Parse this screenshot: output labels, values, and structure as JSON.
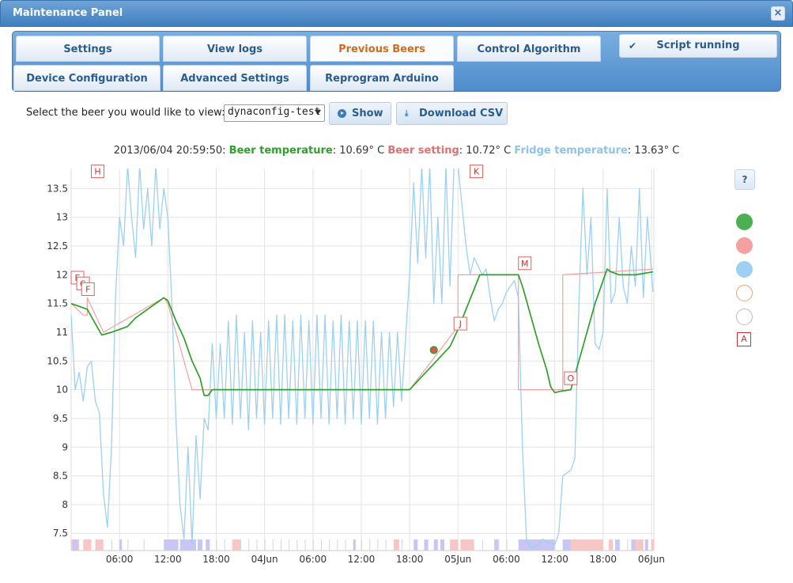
{
  "window": {
    "title": "Maintenance Panel",
    "close_glyph": "×"
  },
  "tabs": [
    {
      "label": "Settings",
      "active": false
    },
    {
      "label": "View logs",
      "active": false
    },
    {
      "label": "Previous Beers",
      "active": true
    },
    {
      "label": "Control Algorithm",
      "active": false
    },
    {
      "label": "Device Configuration",
      "active": false
    },
    {
      "label": "Advanced Settings",
      "active": false
    },
    {
      "label": "Reprogram Arduino",
      "active": false
    }
  ],
  "script_status": {
    "label": "Script running",
    "icon": "check-icon"
  },
  "controls": {
    "select_label": "Select the beer you would like to view:",
    "beer_value": "dynaconfig-test",
    "show_label": "Show",
    "show_icon": "play-circle-icon",
    "download_label": "Download CSV",
    "download_icon": "download-icon"
  },
  "readout": {
    "timestamp": "2013/06/04 20:59:50:",
    "beer_label": "Beer temperature",
    "beer_value": ": 10.69° C",
    "setting_label": "Beer setting",
    "setting_value": ": 10.72° C",
    "fridge_label": "Fridge temperature",
    "fridge_value": ": 13.63° C"
  },
  "legend": {
    "help_label": "?",
    "colors": [
      "#4caf50",
      "#f4a0a0",
      "#9fd0f3",
      "#f0a060",
      "#cccccc"
    ],
    "annotations_label": "A"
  },
  "colors": {
    "beer": "#2ea02a",
    "setting": "#f3a0a0",
    "fridge": "#9dd0f2",
    "accent": "#d06b1e"
  },
  "chart_data": {
    "type": "line",
    "x_unit": "hours since 2013-06-03 00:00",
    "x_tick_labels": [
      "06:00",
      "12:00",
      "18:00",
      "04Jun",
      "06:00",
      "12:00",
      "18:00",
      "05Jun",
      "06:00",
      "12:00",
      "18:00",
      "06Jun"
    ],
    "x_ticks": [
      6,
      12,
      18,
      24,
      30,
      36,
      42,
      48,
      54,
      60,
      66,
      72
    ],
    "xlim": [
      0,
      72.3
    ],
    "ylim": [
      7.2,
      13.85
    ],
    "y_ticks": [
      7.5,
      8,
      8.5,
      9,
      9.5,
      10,
      10.5,
      11,
      11.5,
      12,
      12.5,
      13,
      13.5
    ],
    "series": [
      {
        "name": "Beer temperature",
        "points": [
          [
            0,
            11.5
          ],
          [
            2,
            11.4
          ],
          [
            3.8,
            10.95
          ],
          [
            5,
            11.0
          ],
          [
            6,
            11.05
          ],
          [
            7,
            11.1
          ],
          [
            8,
            11.25
          ],
          [
            10,
            11.45
          ],
          [
            11.5,
            11.6
          ],
          [
            12,
            11.55
          ],
          [
            13,
            11.2
          ],
          [
            14,
            10.9
          ],
          [
            15,
            10.5
          ],
          [
            16,
            10.2
          ],
          [
            16.5,
            9.9
          ],
          [
            17,
            9.9
          ],
          [
            17.5,
            10.0
          ],
          [
            18,
            10.0
          ],
          [
            42,
            10.0
          ],
          [
            44,
            10.3
          ],
          [
            46,
            10.6
          ],
          [
            47,
            10.75
          ],
          [
            48,
            11.05
          ],
          [
            49,
            11.4
          ],
          [
            50,
            11.75
          ],
          [
            50.7,
            12.0
          ],
          [
            55.5,
            12.0
          ],
          [
            56,
            11.8
          ],
          [
            57,
            11.3
          ],
          [
            58,
            10.8
          ],
          [
            59,
            10.35
          ],
          [
            59.5,
            10.05
          ],
          [
            60,
            9.95
          ],
          [
            61,
            9.98
          ],
          [
            62,
            10.0
          ],
          [
            63,
            10.5
          ],
          [
            64,
            11.0
          ],
          [
            65,
            11.5
          ],
          [
            66,
            11.9
          ],
          [
            66.5,
            12.1
          ],
          [
            67,
            12.05
          ],
          [
            68,
            12.0
          ],
          [
            70,
            12.0
          ],
          [
            72.2,
            12.05
          ]
        ]
      },
      {
        "name": "Beer setting",
        "points": [
          [
            0,
            11.5
          ],
          [
            1.5,
            11.3
          ],
          [
            2,
            11.3
          ],
          [
            2,
            11.6
          ],
          [
            4,
            11.0
          ],
          [
            11.5,
            11.6
          ],
          [
            12,
            11.5
          ],
          [
            13,
            11.0
          ],
          [
            14,
            10.5
          ],
          [
            15,
            10.0
          ],
          [
            42,
            10.0
          ],
          [
            48,
            11.1
          ],
          [
            48,
            12.0
          ],
          [
            55.5,
            12.0
          ],
          [
            55.5,
            10.0
          ],
          [
            60.5,
            10.0
          ],
          [
            61,
            10.0
          ],
          [
            61,
            12.0
          ],
          [
            72.2,
            12.1
          ]
        ]
      },
      {
        "name": "Fridge temperature",
        "points": [
          [
            0,
            11.3
          ],
          [
            0.5,
            10.0
          ],
          [
            1,
            10.3
          ],
          [
            1.5,
            9.8
          ],
          [
            2,
            10.4
          ],
          [
            2.5,
            10.5
          ],
          [
            3,
            9.8
          ],
          [
            3.5,
            9.6
          ],
          [
            4,
            8.2
          ],
          [
            4.5,
            7.6
          ],
          [
            5,
            9.0
          ],
          [
            5.5,
            11.6
          ],
          [
            6,
            13.0
          ],
          [
            6.5,
            12.5
          ],
          [
            7,
            13.9
          ],
          [
            7.5,
            13.0
          ],
          [
            8,
            12.3
          ],
          [
            8.5,
            13.9
          ],
          [
            9,
            12.8
          ],
          [
            9.5,
            13.5
          ],
          [
            10,
            12.5
          ],
          [
            10.5,
            13.9
          ],
          [
            11,
            12.8
          ],
          [
            11.5,
            13.5
          ],
          [
            12,
            13.0
          ],
          [
            12.5,
            11.5
          ],
          [
            13,
            9.5
          ],
          [
            13.5,
            8.0
          ],
          [
            14,
            7.4
          ],
          [
            14.5,
            9.0
          ],
          [
            15,
            7.3
          ],
          [
            15.5,
            9.2
          ],
          [
            16,
            8.1
          ],
          [
            16.5,
            9.5
          ],
          [
            17,
            9.3
          ],
          [
            17.5,
            10.8
          ],
          [
            18,
            9.5
          ],
          [
            18.5,
            10.8
          ],
          [
            19,
            9.5
          ],
          [
            19.5,
            11.2
          ],
          [
            20,
            9.4
          ],
          [
            20.5,
            11.3
          ],
          [
            21,
            9.5
          ],
          [
            21.5,
            11.0
          ],
          [
            22,
            9.3
          ],
          [
            22.5,
            11.2
          ],
          [
            23,
            9.5
          ],
          [
            23.5,
            11.0
          ],
          [
            24,
            9.4
          ],
          [
            24.5,
            11.2
          ],
          [
            25,
            9.5
          ],
          [
            25.5,
            11.3
          ],
          [
            26,
            9.4
          ],
          [
            26.5,
            11.3
          ],
          [
            27,
            9.5
          ],
          [
            27.5,
            11.2
          ],
          [
            28,
            9.4
          ],
          [
            28.5,
            11.3
          ],
          [
            29,
            9.5
          ],
          [
            29.5,
            11.2
          ],
          [
            30,
            9.4
          ],
          [
            30.5,
            11.3
          ],
          [
            31,
            9.5
          ],
          [
            31.5,
            11.3
          ],
          [
            32,
            9.4
          ],
          [
            32.5,
            11.2
          ],
          [
            33,
            9.5
          ],
          [
            33.5,
            11.3
          ],
          [
            34,
            9.4
          ],
          [
            34.5,
            11.2
          ],
          [
            35,
            9.5
          ],
          [
            35.5,
            11.2
          ],
          [
            36,
            9.4
          ],
          [
            36.5,
            11.2
          ],
          [
            37,
            9.5
          ],
          [
            37.5,
            11.2
          ],
          [
            38,
            9.4
          ],
          [
            38.5,
            11.0
          ],
          [
            39,
            9.5
          ],
          [
            39.5,
            11.0
          ],
          [
            40,
            9.7
          ],
          [
            40.5,
            11.0
          ],
          [
            41,
            9.8
          ],
          [
            41.5,
            10.9
          ],
          [
            42,
            12.0
          ],
          [
            42.5,
            13.6
          ],
          [
            43,
            12.2
          ],
          [
            43.5,
            13.9
          ],
          [
            44,
            12.3
          ],
          [
            44.5,
            13.9
          ],
          [
            45,
            11.5
          ],
          [
            45.5,
            13.0
          ],
          [
            46,
            11.5
          ],
          [
            46.5,
            13.9
          ],
          [
            47,
            11.8
          ],
          [
            47.5,
            13.9
          ],
          [
            48,
            13.9
          ],
          [
            49,
            12.5
          ],
          [
            49.5,
            12.0
          ],
          [
            50,
            12.3
          ],
          [
            51,
            12.0
          ],
          [
            51.5,
            12.1
          ],
          [
            52,
            11.6
          ],
          [
            52.5,
            11.2
          ],
          [
            53,
            11.4
          ],
          [
            53.5,
            11.5
          ],
          [
            54,
            11.7
          ],
          [
            55,
            11.9
          ],
          [
            55.5,
            11.6
          ],
          [
            56,
            9.0
          ],
          [
            56.5,
            7.4
          ],
          [
            57,
            7.25
          ],
          [
            58,
            7.3
          ],
          [
            58.5,
            7.4
          ],
          [
            59,
            7.35
          ],
          [
            60,
            7.3
          ],
          [
            60.5,
            7.5
          ],
          [
            61,
            8.5
          ],
          [
            62,
            8.6
          ],
          [
            62.5,
            8.8
          ],
          [
            63,
            11.5
          ],
          [
            63.5,
            13.5
          ],
          [
            64,
            12.0
          ],
          [
            64.5,
            13.0
          ],
          [
            65,
            10.8
          ],
          [
            65.5,
            10.7
          ],
          [
            66,
            11.0
          ],
          [
            66.5,
            13.5
          ],
          [
            67,
            11.5
          ],
          [
            67.5,
            11.7
          ],
          [
            68,
            13.0
          ],
          [
            68.5,
            11.8
          ],
          [
            69,
            11.5
          ],
          [
            69.5,
            12.5
          ],
          [
            70,
            11.8
          ],
          [
            70.5,
            13.5
          ],
          [
            71,
            11.6
          ],
          [
            71.5,
            13.0
          ],
          [
            72.2,
            11.7
          ]
        ]
      }
    ],
    "current_point": {
      "x": 45,
      "y": 10.69
    },
    "annotations": [
      {
        "label": "H",
        "x": 2.5,
        "y": 13.8
      },
      {
        "label": "K",
        "x": 49.5,
        "y": 13.8
      },
      {
        "label": "E",
        "x": 0,
        "y": 11.95
      },
      {
        "label": "G",
        "x": 0.7,
        "y": 11.85
      },
      {
        "label": "F",
        "x": 1.3,
        "y": 11.75
      },
      {
        "label": "J",
        "x": 47.5,
        "y": 11.15
      },
      {
        "label": "M",
        "x": 55.5,
        "y": 12.2
      },
      {
        "label": "O",
        "x": 61.2,
        "y": 10.2
      }
    ],
    "heater_bands": [
      [
        0,
        1
      ],
      [
        1.5,
        2.5
      ],
      [
        3,
        4
      ],
      [
        20,
        21
      ],
      [
        40,
        40.7
      ],
      [
        47,
        48
      ],
      [
        48.3,
        50
      ],
      [
        62,
        66
      ],
      [
        66.7,
        67.2
      ],
      [
        70,
        71
      ],
      [
        72,
        72.3
      ]
    ],
    "cooler_bands": [
      [
        0.2,
        0.8
      ],
      [
        6,
        6.3
      ],
      [
        11.5,
        12
      ],
      [
        12,
        13.3
      ],
      [
        13.5,
        15.5
      ],
      [
        15.7,
        16.3
      ],
      [
        16.7,
        17.2
      ],
      [
        35,
        35.3
      ],
      [
        42.5,
        43
      ],
      [
        43.8,
        44.3
      ],
      [
        45,
        45.5
      ],
      [
        45.8,
        46.3
      ],
      [
        52.5,
        53
      ],
      [
        55.5,
        60
      ],
      [
        61,
        62
      ],
      [
        67.5,
        68
      ],
      [
        69.5,
        70
      ],
      [
        71.2,
        71.6
      ]
    ],
    "tick_bands": [
      [
        2,
        2.1
      ],
      [
        5,
        5.1
      ],
      [
        7,
        7.1
      ],
      [
        9,
        9.1
      ],
      [
        18,
        18.1
      ],
      [
        19,
        19.1
      ],
      [
        21,
        21.1
      ],
      [
        22,
        22.1
      ],
      [
        23,
        23.1
      ],
      [
        24,
        24.1
      ],
      [
        25,
        25.1
      ],
      [
        26,
        26.1
      ],
      [
        27,
        27.1
      ],
      [
        28,
        28.1
      ],
      [
        29,
        29.1
      ],
      [
        30,
        30.1
      ],
      [
        31,
        31.1
      ],
      [
        32,
        32.1
      ],
      [
        33,
        33.1
      ],
      [
        34,
        34.1
      ],
      [
        36,
        36.1
      ],
      [
        37,
        37.1
      ],
      [
        38,
        38.1
      ],
      [
        39,
        39.1
      ],
      [
        41,
        41.1
      ],
      [
        51,
        51.1
      ],
      [
        53,
        53.1
      ],
      [
        54,
        54.1
      ],
      [
        61,
        61.1
      ],
      [
        62,
        62.1
      ],
      [
        63,
        63.1
      ],
      [
        68,
        68.1
      ],
      [
        69,
        69.1
      ],
      [
        70,
        70.1
      ]
    ]
  }
}
